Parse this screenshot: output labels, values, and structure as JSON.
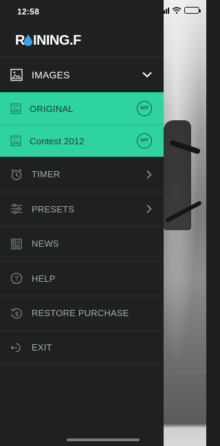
{
  "status_bar": {
    "time": "12:58"
  },
  "app": {
    "logo": "RAINING.FM"
  },
  "menu": {
    "header": {
      "label": "IMAGES",
      "icon": "image-icon",
      "chevron": "chevron-down-icon"
    },
    "images": [
      {
        "label": "ORIGINAL",
        "toggle": "OFF",
        "icon": "image-icon"
      },
      {
        "label": "Contest 2012",
        "toggle": "OFF",
        "icon": "image-icon"
      }
    ],
    "items": [
      {
        "label": "TIMER",
        "icon": "alarm-clock-icon",
        "has_chevron": true
      },
      {
        "label": "PRESETS",
        "icon": "sliders-icon",
        "has_chevron": true
      },
      {
        "label": "NEWS",
        "icon": "newspaper-icon",
        "has_chevron": false
      },
      {
        "label": "HELP",
        "icon": "help-icon",
        "has_chevron": false
      },
      {
        "label": "RESTORE PURCHASE",
        "icon": "restore-purchase-icon",
        "has_chevron": false
      },
      {
        "label": "EXIT",
        "icon": "exit-icon",
        "has_chevron": false
      }
    ]
  },
  "colors": {
    "accent": "#2fd3a0",
    "drawer": "#1f2020",
    "text": "#a4acad"
  }
}
